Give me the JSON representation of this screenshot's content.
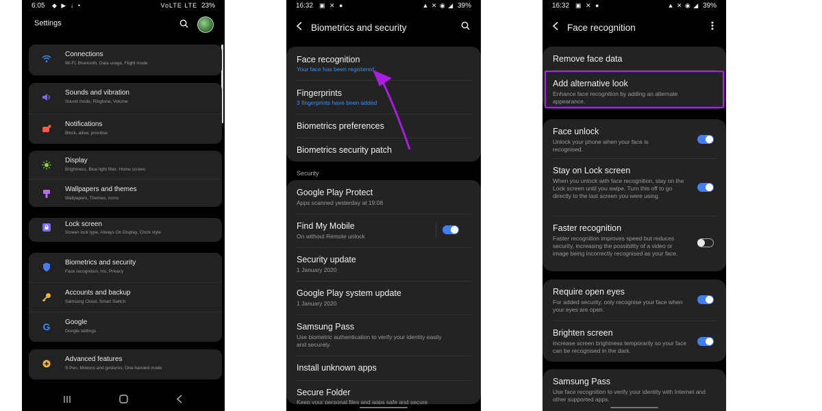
{
  "screen1": {
    "status": {
      "time": "6:05",
      "right_icons": "VoLTE LTE",
      "battery": "23%"
    },
    "title": "Settings",
    "items": [
      {
        "title": "Connections",
        "subtitle": "Wi-Fi, Bluetooth, Data usage, Flight mode",
        "icon": "wifi-icon",
        "color": "#3d8ef0"
      },
      {
        "title": "Sounds and vibration",
        "subtitle": "Sound mode, Ringtone, Volume",
        "icon": "volume-icon",
        "color": "#7a6cf0"
      },
      {
        "title": "Notifications",
        "subtitle": "Block, allow, prioritise",
        "icon": "notification-icon",
        "color": "#f05a4a"
      },
      {
        "title": "Display",
        "subtitle": "Brightness, Blue light filter, Home screen",
        "icon": "sun-icon",
        "color": "#8fd34a"
      },
      {
        "title": "Wallpapers and themes",
        "subtitle": "Wallpapers, Themes, Icons",
        "icon": "paintbrush-icon",
        "color": "#b56cf0"
      },
      {
        "title": "Lock screen",
        "subtitle": "Screen lock type, Always On Display, Clock style",
        "icon": "lock-icon",
        "color": "#7a6cf0"
      },
      {
        "title": "Biometrics and security",
        "subtitle": "Face recognition, Iris, Privacy",
        "icon": "shield-icon",
        "color": "#4a7cf0"
      },
      {
        "title": "Accounts and backup",
        "subtitle": "Samsung Cloud, Smart Switch",
        "icon": "key-icon",
        "color": "#f0b43a"
      },
      {
        "title": "Google",
        "subtitle": "Google settings",
        "icon": "google-icon",
        "color": "#4a8af0"
      },
      {
        "title": "Advanced features",
        "subtitle": "S Pen, Motions and gestures, One-handed mode",
        "icon": "gear-plus-icon",
        "color": "#f0b43a"
      }
    ]
  },
  "screen2": {
    "status": {
      "time": "16:32",
      "battery": "39%"
    },
    "title": "Biometrics and security",
    "biometrics": [
      {
        "title": "Face recognition",
        "subtitle": "Your face has been registered."
      },
      {
        "title": "Fingerprints",
        "subtitle": "3 fingerprints have been added"
      },
      {
        "title": "Biometrics preferences"
      },
      {
        "title": "Biometrics security patch"
      }
    ],
    "security_label": "Security",
    "security": [
      {
        "title": "Google Play Protect",
        "subtitle": "Apps scanned yesterday at 19:08"
      },
      {
        "title": "Find My Mobile",
        "subtitle": "On without Remote unlock",
        "toggle": true
      },
      {
        "title": "Security update",
        "subtitle": "1 January 2020"
      },
      {
        "title": "Google Play system update",
        "subtitle": "1 January 2020"
      },
      {
        "title": "Samsung Pass",
        "subtitle": "Use biometric authentication to verify your identity easily and securely."
      },
      {
        "title": "Install unknown apps"
      },
      {
        "title": "Secure Folder",
        "subtitle": "Keep your personal files and apps safe and secure"
      }
    ]
  },
  "screen3": {
    "status": {
      "time": "16:32",
      "battery": "39%"
    },
    "title": "Face recognition",
    "group1": [
      {
        "title": "Remove face data"
      },
      {
        "title": "Add alternative look",
        "subtitle": "Enhance face recognition by adding an alternate appearance."
      }
    ],
    "group2": [
      {
        "title": "Face unlock",
        "subtitle": "Unlock your phone when your face is recognised.",
        "toggle": true
      },
      {
        "title": "Stay on Lock screen",
        "subtitle": "When you unlock with face recognition, stay on the Lock screen until you swipe. Turn this off to go directly to the last screen you were using.",
        "toggle": true
      },
      {
        "title": "Faster recognition",
        "subtitle": "Faster recognition improves speed but reduces security, increasing the possibility of a video or image being incorrectly recognised as your face.",
        "toggle": false
      }
    ],
    "group3": [
      {
        "title": "Require open eyes",
        "subtitle": "For added security, only recognise your face when your eyes are open.",
        "toggle": true
      },
      {
        "title": "Brighten screen",
        "subtitle": "Increase screen brightness temporarily so your face can be recognised in the dark.",
        "toggle": true
      }
    ],
    "group4": [
      {
        "title": "Samsung Pass",
        "subtitle": "Use face recognition to verify your identity with Internet and other supported apps."
      }
    ]
  },
  "colors": {
    "accent": "#3f7ff0",
    "highlight": "#b01ef0",
    "card": "#232323",
    "link": "#3d8ef0"
  }
}
